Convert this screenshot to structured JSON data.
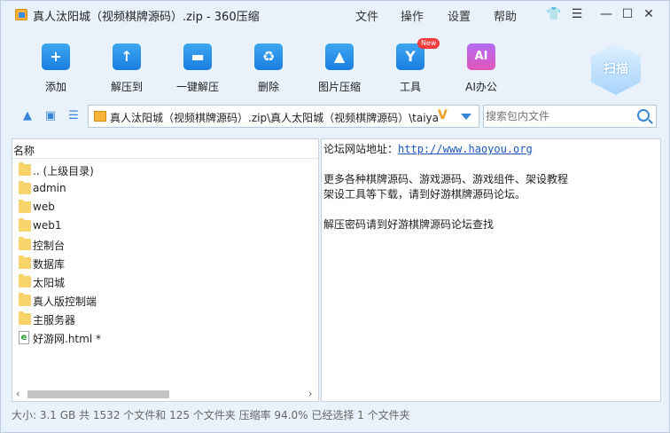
{
  "window": {
    "title": "真人汰阳城（视频棋牌源码）.zip - 360压缩",
    "menu": [
      "文件",
      "操作",
      "设置",
      "帮助"
    ]
  },
  "toolbar": {
    "items": [
      {
        "label": "添加",
        "icon": "add-icon",
        "glyph": "+"
      },
      {
        "label": "解压到",
        "icon": "extract-to-icon",
        "glyph": "↑"
      },
      {
        "label": "一键解压",
        "icon": "one-click-extract-icon",
        "glyph": "▬"
      },
      {
        "label": "删除",
        "icon": "delete-icon",
        "glyph": "♻"
      },
      {
        "label": "图片压缩",
        "icon": "image-compress-icon",
        "glyph": "▲"
      },
      {
        "label": "工具",
        "icon": "tools-icon",
        "glyph": "Y",
        "badge": "New"
      },
      {
        "label": "AI办公",
        "icon": "ai-office-icon",
        "glyph": "AI"
      }
    ],
    "scan_label": "扫描"
  },
  "address": {
    "path": "真人汰阳城（视频棋牌源码）.zip\\真人太阳城（视频棋牌源码）\\taiya"
  },
  "search": {
    "placeholder": "搜索包内文件"
  },
  "file_list": {
    "column_name": "名称",
    "items": [
      {
        "name": ".. (上级目录)",
        "type": "folder"
      },
      {
        "name": "admin",
        "type": "folder"
      },
      {
        "name": "web",
        "type": "folder"
      },
      {
        "name": "web1",
        "type": "folder"
      },
      {
        "name": "控制台",
        "type": "folder"
      },
      {
        "name": "数据库",
        "type": "folder"
      },
      {
        "name": "太阳城",
        "type": "folder"
      },
      {
        "name": "真人版控制端",
        "type": "folder"
      },
      {
        "name": "主服务器",
        "type": "folder"
      },
      {
        "name": "好游网.html *",
        "type": "html"
      }
    ]
  },
  "comment": {
    "line1_prefix": "论坛网站地址：",
    "line1_link": "http://www.haoyou.org",
    "line2": "更多各种棋牌源码、游戏源码、游戏组件、架设教程",
    "line3": "架设工具等下载，请到好游棋牌源码论坛。",
    "line4": "解压密码请到好游棋牌源码论坛查找"
  },
  "status": {
    "text": "大小: 3.1 GB 共 1532 个文件和 125 个文件夹 压缩率 94.0% 已经选择 1 个文件夹"
  },
  "colors": {
    "accent": "#1a7ee0",
    "window_bg": "#e9f2fb",
    "badge": "#f23b3b"
  }
}
